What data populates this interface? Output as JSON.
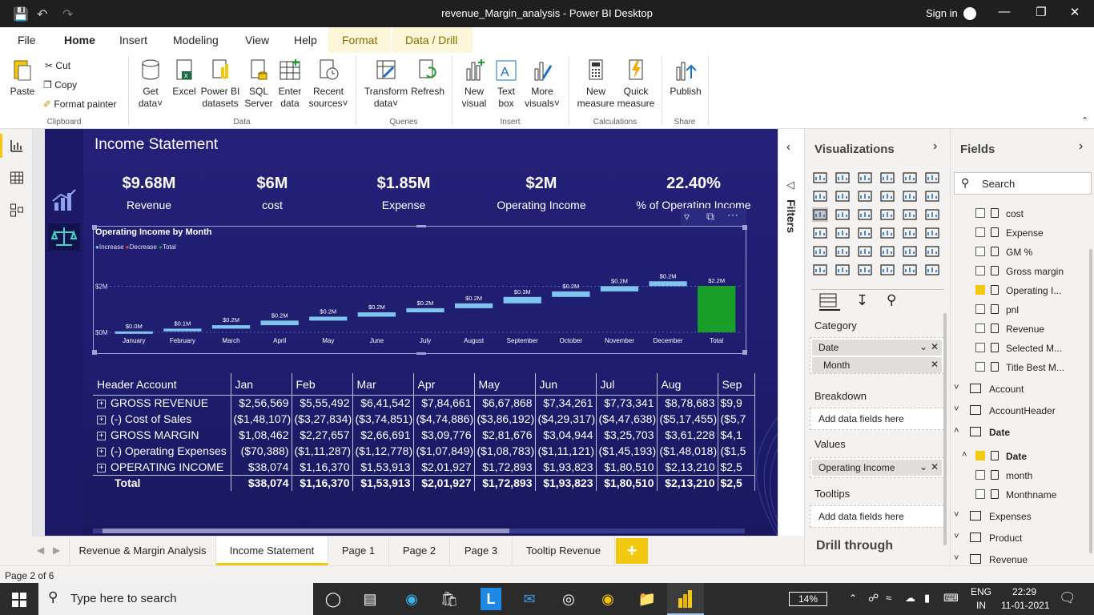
{
  "window": {
    "title": "revenue_Margin_analysis - Power BI Desktop",
    "sign_in": "Sign in"
  },
  "menu": {
    "items": [
      "File",
      "Home",
      "Insert",
      "Modeling",
      "View",
      "Help",
      "Format",
      "Data / Drill"
    ]
  },
  "ribbon": {
    "clipboard": {
      "paste": "Paste",
      "cut": "Cut",
      "copy": "Copy",
      "format_painter": "Format painter",
      "label": "Clipboard"
    },
    "data": {
      "get_data": "Get data",
      "excel": "Excel",
      "pbi_datasets": "Power BI datasets",
      "sql": "SQL Server",
      "enter_data": "Enter data",
      "recent": "Recent sources",
      "label": "Data"
    },
    "queries": {
      "transform": "Transform data",
      "refresh": "Refresh",
      "label": "Queries"
    },
    "insert": {
      "new_visual": "New visual",
      "text_box": "Text box",
      "more_visuals": "More visuals",
      "label": "Insert"
    },
    "calculations": {
      "new_measure": "New measure",
      "quick_measure": "Quick measure",
      "label": "Calculations"
    },
    "share": {
      "publish": "Publish",
      "label": "Share"
    }
  },
  "report": {
    "title": "Income Statement",
    "kpis": [
      {
        "value": "$9.68M",
        "label": "Revenue"
      },
      {
        "value": "$6M",
        "label": "cost"
      },
      {
        "value": "$1.85M",
        "label": "Expense"
      },
      {
        "value": "$2M",
        "label": "Operating Income"
      },
      {
        "value": "22.40%",
        "label": "% of Operating Income"
      }
    ]
  },
  "chart_data": {
    "type": "waterfall",
    "title": "Operating Income by Month",
    "legend": [
      "Increase",
      "Decrease",
      "Total"
    ],
    "colors": {
      "Increase": "#7fc4ef",
      "Decrease": "#e84848",
      "Total": "#1a9e2a"
    },
    "categories": [
      "January",
      "February",
      "March",
      "April",
      "May",
      "June",
      "July",
      "August",
      "September",
      "October",
      "November",
      "December",
      "Total"
    ],
    "values": [
      0.04,
      0.12,
      0.15,
      0.2,
      0.17,
      0.19,
      0.18,
      0.21,
      0.28,
      0.24,
      0.23,
      0.21,
      2.02
    ],
    "data_labels": [
      "$0.0M",
      "$0.1M",
      "$0.2M",
      "$0.2M",
      "$0.2M",
      "$0.2M",
      "$0.2M",
      "$0.2M",
      "$0.3M",
      "$0.2M",
      "$0.2M",
      "$0.2M",
      "$2.2M"
    ],
    "y_ticks": [
      "$0M",
      "$2M"
    ],
    "ylim": [
      0,
      2.3
    ]
  },
  "matrix": {
    "headers": [
      "Header Account",
      "Jan",
      "Feb",
      "Mar",
      "Apr",
      "May",
      "Jun",
      "Jul",
      "Aug",
      "Sep"
    ],
    "rows": [
      {
        "label": "GROSS REVENUE",
        "values": [
          "$2,56,569",
          "$5,55,492",
          "$6,41,542",
          "$7,84,661",
          "$6,67,868",
          "$7,34,261",
          "$7,73,341",
          "$8,78,683",
          "$9,9"
        ]
      },
      {
        "label": "(-) Cost of Sales",
        "values": [
          "($1,48,107)",
          "($3,27,834)",
          "($3,74,851)",
          "($4,74,886)",
          "($3,86,192)",
          "($4,29,317)",
          "($4,47,638)",
          "($5,17,455)",
          "($5,7"
        ]
      },
      {
        "label": "GROSS MARGIN",
        "values": [
          "$1,08,462",
          "$2,27,657",
          "$2,66,691",
          "$3,09,776",
          "$2,81,676",
          "$3,04,944",
          "$3,25,703",
          "$3,61,228",
          "$4,1"
        ]
      },
      {
        "label": "(-) Operating Expenses",
        "values": [
          "($70,388)",
          "($1,11,287)",
          "($1,12,778)",
          "($1,07,849)",
          "($1,08,783)",
          "($1,11,121)",
          "($1,45,193)",
          "($1,48,018)",
          "($1,5"
        ]
      },
      {
        "label": "OPERATING INCOME",
        "values": [
          "$38,074",
          "$1,16,370",
          "$1,53,913",
          "$2,01,927",
          "$1,72,893",
          "$1,93,823",
          "$1,80,510",
          "$2,13,210",
          "$2,5"
        ]
      }
    ],
    "total": {
      "label": "Total",
      "values": [
        "$38,074",
        "$1,16,370",
        "$1,53,913",
        "$2,01,927",
        "$1,72,893",
        "$1,93,823",
        "$1,80,510",
        "$2,13,210",
        "$2,5"
      ]
    }
  },
  "filters_label": "Filters",
  "visualizations": {
    "title": "Visualizations",
    "wells": {
      "category_label": "Category",
      "category_field": "Date",
      "category_sub": "Month",
      "breakdown_label": "Breakdown",
      "breakdown_placeholder": "Add data fields here",
      "values_label": "Values",
      "values_field": "Operating Income",
      "tooltips_label": "Tooltips",
      "tooltips_placeholder": "Add data fields here"
    },
    "drill_through": "Drill through"
  },
  "fields": {
    "title": "Fields",
    "search_placeholder": "Search",
    "measures": [
      {
        "name": "cost",
        "checked": false
      },
      {
        "name": "Expense",
        "checked": false
      },
      {
        "name": "GM %",
        "checked": false
      },
      {
        "name": "Gross margin",
        "checked": false
      },
      {
        "name": "Operating I...",
        "checked": true
      },
      {
        "name": "pnl",
        "checked": false
      },
      {
        "name": "Revenue",
        "checked": false
      },
      {
        "name": "Selected M...",
        "checked": false
      },
      {
        "name": "Title Best M...",
        "checked": false
      }
    ],
    "tables": [
      {
        "name": "Account"
      },
      {
        "name": "AccountHeader"
      },
      {
        "name": "Date"
      }
    ],
    "date_fields": [
      {
        "name": "Date",
        "checked": true
      },
      {
        "name": "month",
        "checked": false
      },
      {
        "name": "Monthname",
        "checked": false
      }
    ],
    "tables_after": [
      {
        "name": "Expenses"
      },
      {
        "name": "Product"
      },
      {
        "name": "Revenue"
      }
    ]
  },
  "pages": {
    "tabs": [
      "Revenue & Margin Analysis",
      "Income Statement",
      "Page 1",
      "Page 2",
      "Page 3",
      "Tooltip Revenue"
    ],
    "active": "Income Statement",
    "add": "+"
  },
  "status": "Page 2 of 6",
  "taskbar": {
    "search_placeholder": "Type here to search",
    "battery": "14%",
    "lang1": "ENG",
    "lang2": "IN",
    "time": "22:29",
    "date": "11-01-2021"
  }
}
